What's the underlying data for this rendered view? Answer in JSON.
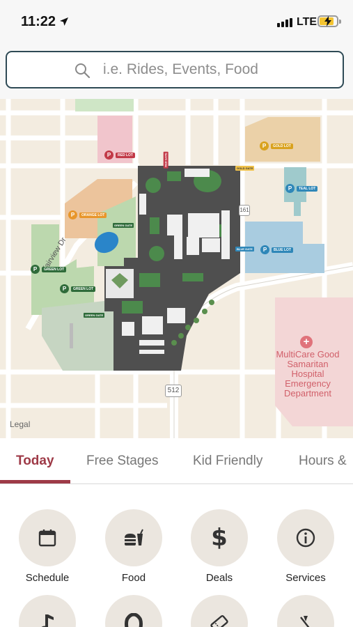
{
  "status_bar": {
    "time": "11:22",
    "network": "LTE",
    "location_icon": "location-arrow-icon",
    "signal_icon": "signal-bars-icon",
    "battery_icon": "battery-charging-icon",
    "battery_color": "#f4c430"
  },
  "search": {
    "placeholder": "i.e. Rides, Events, Food",
    "value": "",
    "icon": "search-icon",
    "border_color": "#2e4a55"
  },
  "map": {
    "legal": "Legal",
    "hospital": {
      "lines": [
        "MultiCare Good",
        "Samaritan",
        "Hospital",
        "Emergency",
        "Department"
      ],
      "color": "#d1606a"
    },
    "road_shields": [
      "512",
      "161"
    ],
    "street": "Fairview Dr",
    "parking_lots": [
      {
        "name": "GOLD LOT",
        "color": "#d9a21e"
      },
      {
        "name": "ORANGE LOT",
        "color": "#e8962b"
      },
      {
        "name": "BLUE LOT",
        "color": "#2f87b8"
      },
      {
        "name": "GREEN LOT",
        "color": "#2f6b3a"
      },
      {
        "name": "RED LOT",
        "color": "#c23a48"
      },
      {
        "name": "TEAL LOT",
        "color": "#2f87b8"
      }
    ],
    "gates": [
      "GOLD GATE",
      "BLUE GATE",
      "GREEN GATE",
      "RED GATE"
    ]
  },
  "tabs": {
    "items": [
      "Today",
      "Free Stages",
      "Kid Friendly",
      "Hours &"
    ],
    "active": "Today",
    "accent": "#9e3a47"
  },
  "categories": [
    {
      "label": "Schedule",
      "icon": "calendar-icon"
    },
    {
      "label": "Food",
      "icon": "burger-drink-icon"
    },
    {
      "label": "Deals",
      "icon": "dollar-icon"
    },
    {
      "label": "Services",
      "icon": "info-icon"
    },
    {
      "label": "",
      "icon": "music-note-icon"
    },
    {
      "label": "",
      "icon": "horseshoe-icon"
    },
    {
      "label": "",
      "icon": "ticket-icon"
    },
    {
      "label": "",
      "icon": "no-ride-icon"
    }
  ]
}
